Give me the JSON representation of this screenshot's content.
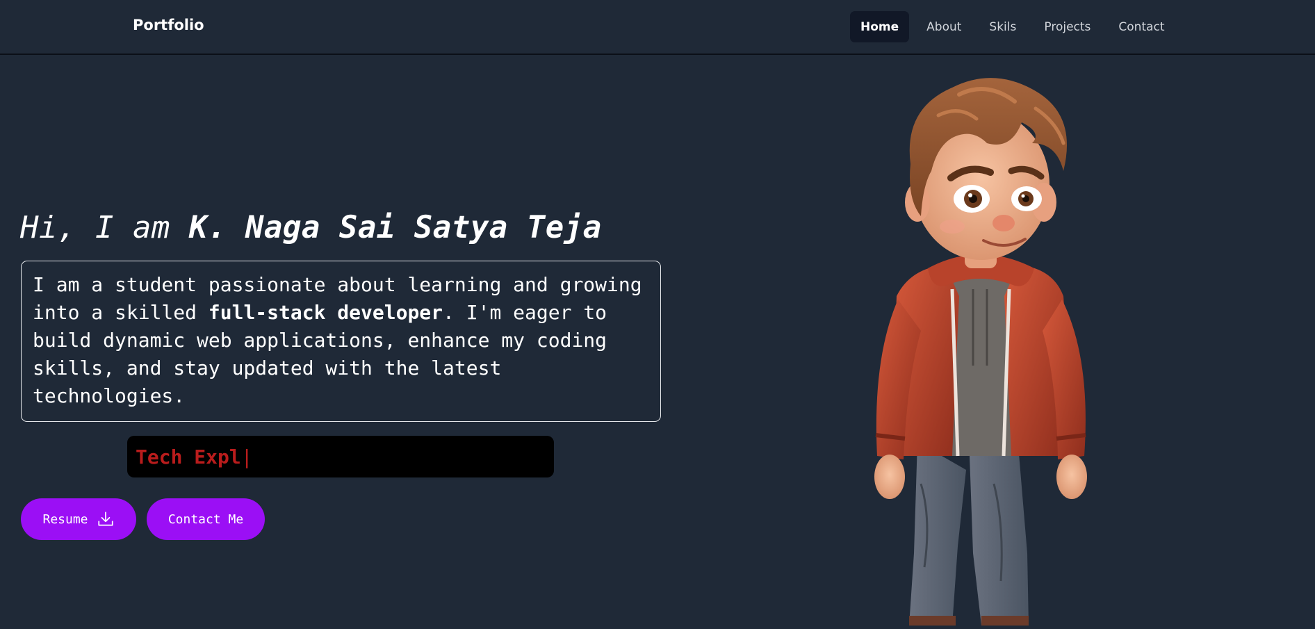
{
  "nav": {
    "brand": "Portfolio",
    "links": [
      {
        "label": "Home",
        "active": true
      },
      {
        "label": "About",
        "active": false
      },
      {
        "label": "Skils",
        "active": false
      },
      {
        "label": "Projects",
        "active": false
      },
      {
        "label": "Contact",
        "active": false
      }
    ]
  },
  "hero": {
    "greeting": "Hi, I am ",
    "name": "K. Naga Sai Satya Teja",
    "intro_part1": "I am a student passionate about learning and growing into a skilled ",
    "intro_bold": "full-stack developer",
    "intro_part2": ". I'm eager to build dynamic web applications, enhance my coding skills, and stay updated with the latest technologies.",
    "typing_text": "Tech Expl",
    "typing_cursor": "|"
  },
  "buttons": {
    "resume": "Resume",
    "contact": "Contact Me"
  },
  "colors": {
    "background": "#1f2937",
    "accent": "#9b0ff5",
    "typing_text": "#b91c1c"
  },
  "icons": {
    "resume_icon": "download-icon"
  }
}
